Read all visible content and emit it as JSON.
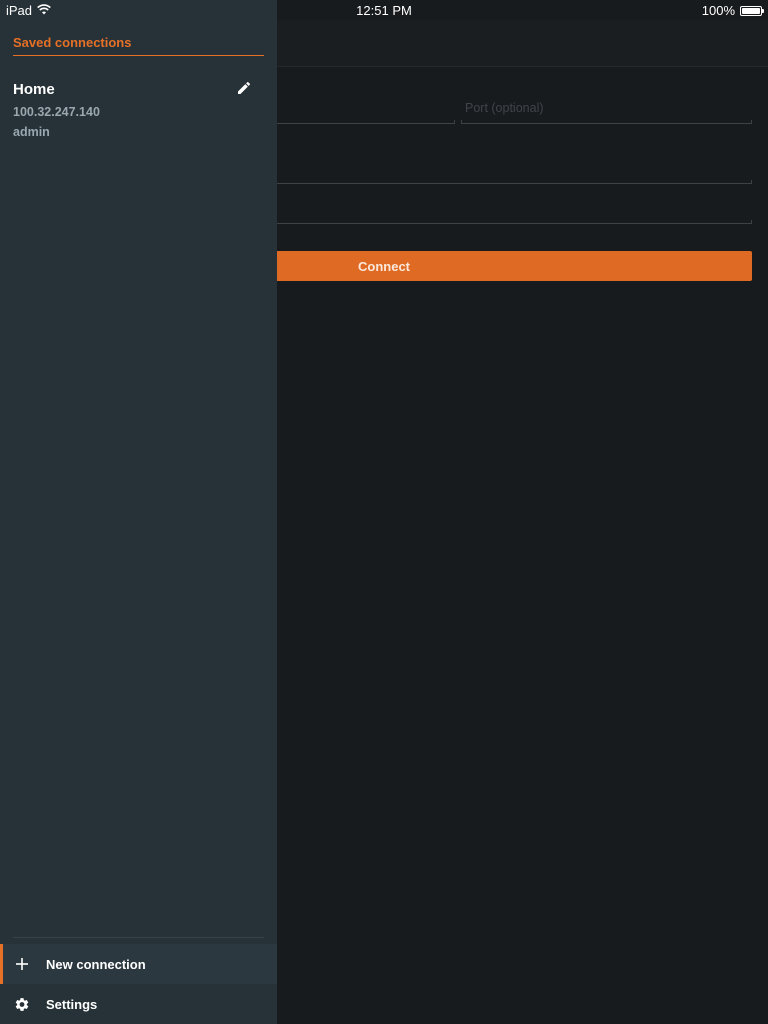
{
  "status_bar": {
    "device": "iPad",
    "time": "12:51 PM",
    "battery": "100%"
  },
  "form": {
    "port_placeholder": "Port (optional)",
    "connect_label": "Connect"
  },
  "drawer": {
    "title": "Saved connections",
    "connections": [
      {
        "name": "Home",
        "host": "100.32.247.140",
        "user": "admin"
      }
    ],
    "menu": {
      "new_connection": "New connection",
      "settings": "Settings"
    }
  },
  "colors": {
    "accent": "#e67026",
    "drawer_bg": "#263238",
    "main_bg": "#181b1e",
    "button_bg": "#df6a23"
  },
  "icons": {
    "wifi": "wifi-icon",
    "edit": "pencil-icon",
    "add": "plus-icon",
    "settings": "gear-icon"
  }
}
